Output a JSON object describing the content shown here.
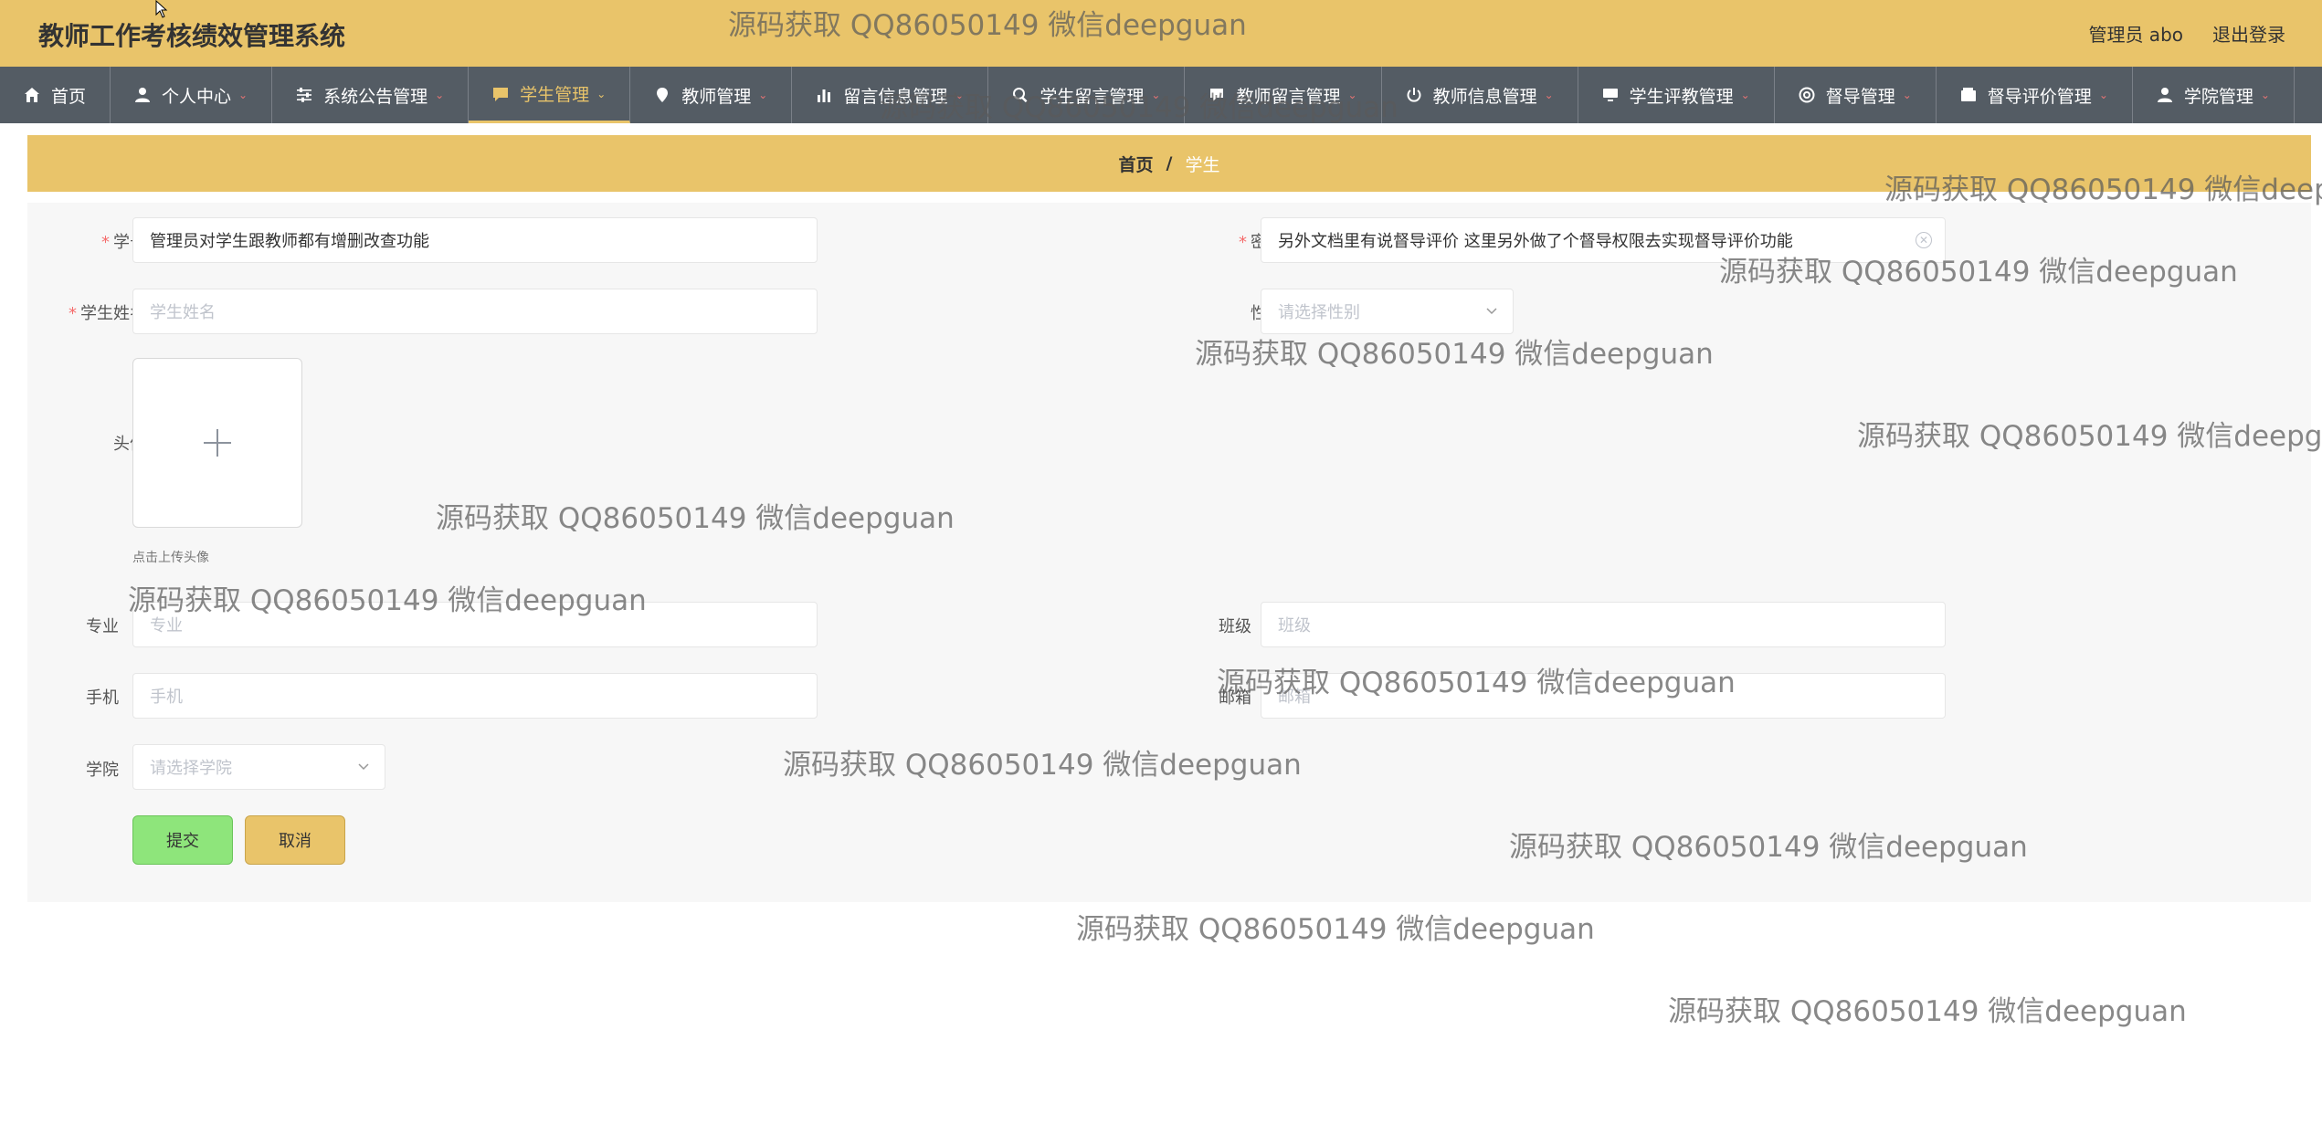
{
  "header": {
    "title": "教师工作考核绩效管理系统",
    "admin_text": "管理员 abo",
    "logout": "退出登录"
  },
  "nav": [
    {
      "label": "首页",
      "icon": "home-icon",
      "chevron": false,
      "active": false
    },
    {
      "label": "个人中心",
      "icon": "user-icon",
      "chevron": true,
      "active": false
    },
    {
      "label": "系统公告管理",
      "icon": "sliders-icon",
      "chevron": true,
      "active": false
    },
    {
      "label": "学生管理",
      "icon": "chat-icon",
      "chevron": true,
      "active": true
    },
    {
      "label": "教师管理",
      "icon": "location-icon",
      "chevron": true,
      "active": false
    },
    {
      "label": "留言信息管理",
      "icon": "bar-chart-icon",
      "chevron": true,
      "active": false
    },
    {
      "label": "学生留言管理",
      "icon": "search-icon",
      "chevron": true,
      "active": false
    },
    {
      "label": "教师留言管理",
      "icon": "chat-bubble-icon",
      "chevron": true,
      "active": false
    },
    {
      "label": "教师信息管理",
      "icon": "power-icon",
      "chevron": true,
      "active": false
    },
    {
      "label": "学生评教管理",
      "icon": "monitor-icon",
      "chevron": true,
      "active": false
    },
    {
      "label": "督导管理",
      "icon": "help-circle-icon",
      "chevron": true,
      "active": false
    },
    {
      "label": "督导评价管理",
      "icon": "wallet-icon",
      "chevron": true,
      "active": false
    },
    {
      "label": "学院管理",
      "icon": "user-icon",
      "chevron": true,
      "active": false
    }
  ],
  "breadcrumb": {
    "home": "首页",
    "separator": "/",
    "current": "学生"
  },
  "form": {
    "student_id": {
      "label": "学号",
      "value": "管理员对学生跟教师都有增删改查功能"
    },
    "password": {
      "label": "密码",
      "value": "另外文档里有说督导评价  这里另外做了个督导权限去实现督导评价功能"
    },
    "student_name": {
      "label": "学生姓名",
      "placeholder": "学生姓名"
    },
    "gender": {
      "label": "性别",
      "placeholder": "请选择性别"
    },
    "avatar": {
      "label": "头像",
      "hint": "点击上传头像"
    },
    "major": {
      "label": "专业",
      "placeholder": "专业"
    },
    "class": {
      "label": "班级",
      "placeholder": "班级"
    },
    "phone": {
      "label": "手机",
      "placeholder": "手机"
    },
    "email": {
      "label": "邮箱",
      "placeholder": "邮箱"
    },
    "college": {
      "label": "学院",
      "placeholder": "请选择学院"
    },
    "submit": "提交",
    "cancel": "取消"
  },
  "watermark": "源码获取 QQ86050149 微信deepguan"
}
